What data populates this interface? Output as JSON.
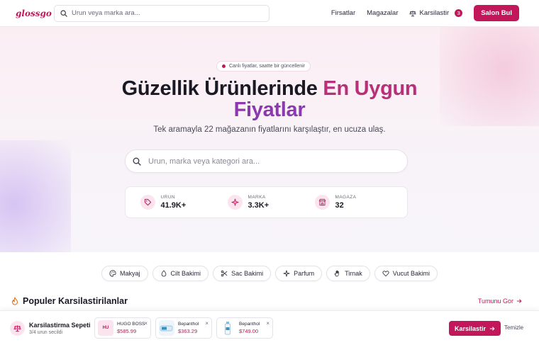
{
  "header": {
    "logo": "glossgo",
    "search_placeholder": "Urun veya marka ara...",
    "nav": {
      "deals": "Firsatlar",
      "stores": "Magazalar",
      "compare": "Karsilastir",
      "compare_count": "3"
    },
    "cta": "Salon Bul"
  },
  "hero": {
    "live_label": "Canlı fiyatlar, saatte bir güncellenir",
    "title_part1": "Güzellik Ürünlerinde ",
    "title_part2": "En Uygun",
    "title_part3": "Fiyatlar",
    "subtitle": "Tek aramayla 22 mağazanın fiyatlarını karşılaştır, en ucuza ulaş.",
    "search_placeholder": "Urun, marka veya kategori ara...",
    "stats": [
      {
        "label": "URUN",
        "value": "41.9K+",
        "icon": "tag-icon"
      },
      {
        "label": "MARKA",
        "value": "3.3K+",
        "icon": "sparkle-icon"
      },
      {
        "label": "MAGAZA",
        "value": "32",
        "icon": "store-icon"
      }
    ]
  },
  "categories": [
    {
      "label": "Makyaj",
      "icon": "palette-icon"
    },
    {
      "label": "Cilt Bakimi",
      "icon": "drop-icon"
    },
    {
      "label": "Sac Bakimi",
      "icon": "scissors-icon"
    },
    {
      "label": "Parfum",
      "icon": "sparkle-icon"
    },
    {
      "label": "Tirnak",
      "icon": "hand-icon"
    },
    {
      "label": "Vucut Bakimi",
      "icon": "heart-icon"
    }
  ],
  "popular": {
    "title": "Populer Karsilastirilanlar",
    "see_all": "Tumunu Gor"
  },
  "compare_bar": {
    "title": "Karsilastirma Sepeti",
    "subtitle": "3/4 urun secildi",
    "items": [
      {
        "thumb": "HU",
        "name": "HUGO BOSS",
        "price": "$585.99"
      },
      {
        "thumb": "",
        "name": "Bepanthol",
        "price": "$363.29"
      },
      {
        "thumb": "",
        "name": "Bepanthol",
        "price": "$749.00"
      }
    ],
    "compare_label": "Karsilastir",
    "clear_label": "Temizle"
  },
  "colors": {
    "accent": "#c2185b",
    "title_pink": "#b8307a",
    "title_purple": "#8a3aae"
  }
}
